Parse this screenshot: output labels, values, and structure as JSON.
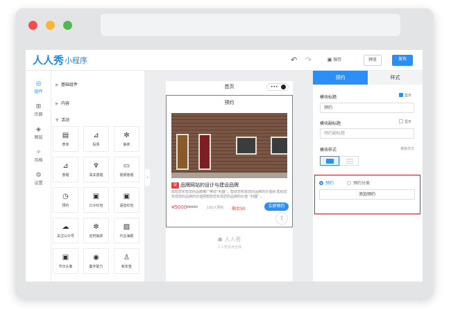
{
  "app": {
    "logo": "人人秀",
    "subtitle": "小程序"
  },
  "toolbar": {
    "undo_icon": "undo-icon",
    "redo_icon": "redo-icon",
    "save_label": "保存",
    "preview_label": "预览",
    "publish_label": "发布"
  },
  "icon_rail": [
    {
      "label": "组件",
      "icon": "components-icon",
      "active": true
    },
    {
      "label": "页面",
      "icon": "page-icon"
    },
    {
      "label": "图层",
      "icon": "layers-icon"
    },
    {
      "label": "风格",
      "icon": "palette-icon"
    },
    {
      "label": "设置",
      "icon": "settings-icon"
    }
  ],
  "component_panel": {
    "categories": [
      {
        "label": "基础组件",
        "expanded": false
      },
      {
        "label": "内容",
        "expanded": false
      },
      {
        "label": "活动",
        "expanded": true
      }
    ],
    "activity_items": [
      "表单",
      "投票",
      "抽奖",
      "答题",
      "闯关答题",
      "视频答题",
      "预约",
      "口令红包",
      "语音红包",
      "关注公众号",
      "定时抽奖",
      "代言海报",
      "节日头像",
      "集字助力",
      "新年签"
    ]
  },
  "phone": {
    "page_title": "首页",
    "capsule_more": "•••",
    "module_title": "预约",
    "product": {
      "tag": "促",
      "title": "品牌网站的设计与建设品牌",
      "description": "帮助您实现您的品牌推广带动“利器”，帮助您实现您的品牌的价值网 帮助您实现您的品牌的价值网帮助您实现您的品牌的价值 “利器”...",
      "price": "¥5000",
      "old_price": "¥8000",
      "booked": "150人预约",
      "remaining": "剩余50",
      "book_button": "立即预约"
    },
    "footer_logo": "人人秀",
    "footer_text": "人人秀技术支持"
  },
  "properties": {
    "tabs": [
      "预约",
      "样式"
    ],
    "module_title_label": "模块标题",
    "show_label": "显示",
    "module_title_value": "预约",
    "subtitle_label": "模块副标题",
    "subtitle_placeholder": "预约副标题",
    "style_label": "模块样式",
    "style_hint": "横板样式",
    "radio_booking": "预约",
    "radio_category": "预约分类",
    "add_button": "添加预约"
  },
  "colors": {
    "accent": "#2b8ff5",
    "danger": "#f03c3c",
    "highlight_border": "#e02020"
  }
}
